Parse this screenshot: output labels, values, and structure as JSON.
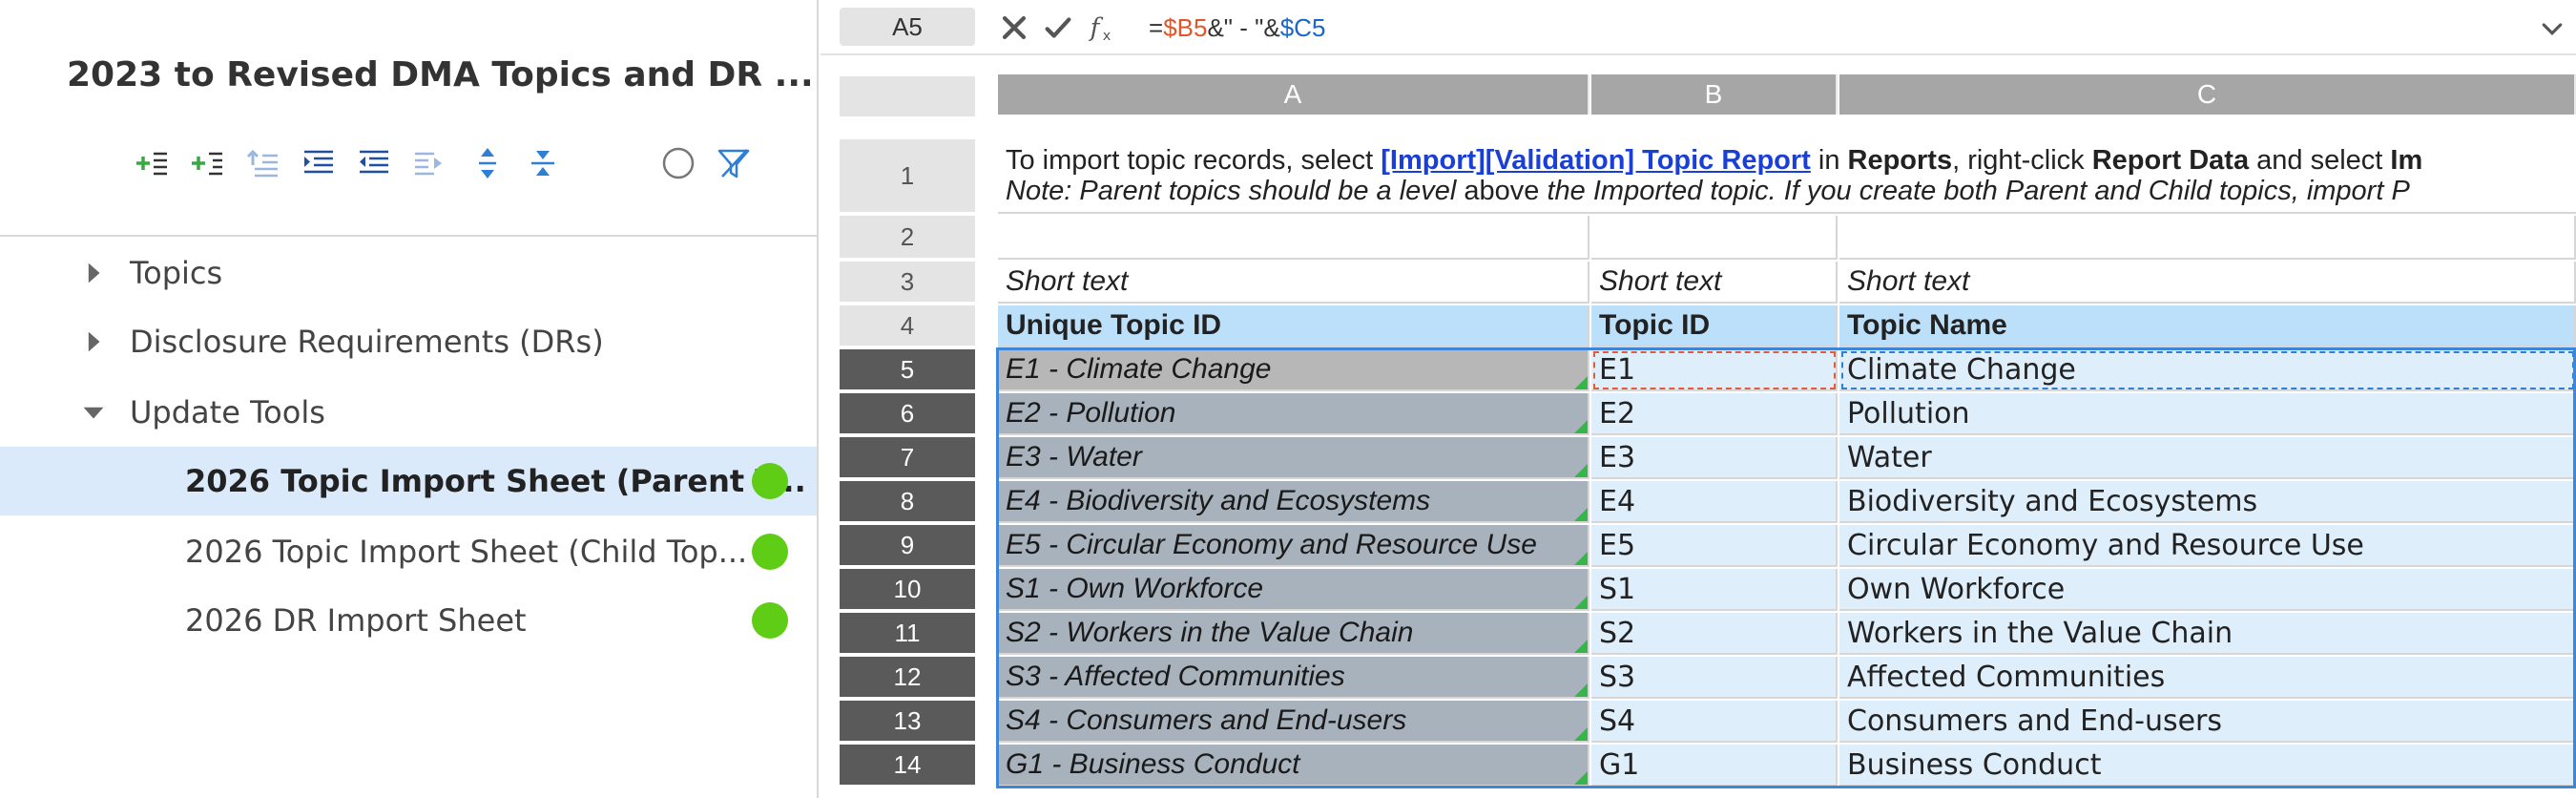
{
  "left_panel": {
    "title": "2023 to Revised DMA Topics and DR ...",
    "toolbar": [
      {
        "name": "add-sibling-icon",
        "color": "#3aa845"
      },
      {
        "name": "add-child-icon",
        "color": "#3aa845"
      },
      {
        "name": "insert-above-icon",
        "color": "#9bb7e0"
      },
      {
        "name": "indent-icon",
        "color": "#1f4f9e"
      },
      {
        "name": "outdent-icon",
        "color": "#1f4f9e"
      },
      {
        "name": "move-right-icon",
        "color": "#9bb7e0"
      },
      {
        "name": "expand-all-icon",
        "color": "#2f7fd6"
      },
      {
        "name": "collapse-all-icon",
        "color": "#2f7fd6"
      },
      {
        "name": "circle-icon",
        "color": "#777777"
      },
      {
        "name": "filter-clear-icon",
        "color": "#2f7fd6"
      }
    ],
    "tree": [
      {
        "label": "Topics",
        "caret": "right",
        "level": 0
      },
      {
        "label": "Disclosure Requirements (DRs)",
        "caret": "right",
        "level": 0
      },
      {
        "label": "Update Tools",
        "caret": "down",
        "level": 0
      },
      {
        "label": "2026 Topic Import Sheet (Parent T...",
        "level": 1,
        "selected": true,
        "status_color": "#5fcc16"
      },
      {
        "label": "2026 Topic Import Sheet (Child Top...",
        "level": 1,
        "selected": false,
        "status_color": "#5fcc16"
      },
      {
        "label": "2026 DR Import Sheet",
        "level": 1,
        "selected": false,
        "status_color": "#5fcc16"
      }
    ]
  },
  "formula_bar": {
    "cell_ref": "A5",
    "formula_parts": [
      {
        "text": "=",
        "style": "plain"
      },
      {
        "text": "$B5",
        "style": "orange"
      },
      {
        "text": "&\" - \"&",
        "style": "plain"
      },
      {
        "text": "$C5",
        "style": "blue"
      }
    ]
  },
  "grid": {
    "columns": [
      "A",
      "B",
      "C"
    ],
    "row1": {
      "line1_parts": [
        {
          "text": "To import topic records, select ",
          "style": "plain"
        },
        {
          "text": "[Import][Validation] Topic Report",
          "style": "link"
        },
        {
          "text": " in ",
          "style": "plain"
        },
        {
          "text": "Reports",
          "style": "bold"
        },
        {
          "text": ", right-click ",
          "style": "plain"
        },
        {
          "text": "Report Data",
          "style": "bold"
        },
        {
          "text": " and select ",
          "style": "plain"
        },
        {
          "text": "Im",
          "style": "bold"
        }
      ],
      "line2_parts": [
        {
          "text": "Note: Parent topics should be a level ",
          "style": "note"
        },
        {
          "text": "above",
          "style": "plain"
        },
        {
          "text": " the Imported topic. If you create both Parent and Child topics, import P",
          "style": "note"
        }
      ]
    },
    "row3": [
      "Short text",
      "Short text",
      "Short text"
    ],
    "row4": [
      "Unique Topic ID",
      "Topic ID",
      "Topic Name"
    ],
    "row_numbers": [
      "1",
      "2",
      "3",
      "4",
      "5",
      "6",
      "7",
      "8",
      "9",
      "10",
      "11",
      "12",
      "13",
      "14"
    ],
    "data_rows": [
      {
        "a": "E1 - Climate Change",
        "b": "E1",
        "c": "Climate Change"
      },
      {
        "a": "E2 - Pollution",
        "b": "E2",
        "c": "Pollution"
      },
      {
        "a": "E3 - Water",
        "b": "E3",
        "c": "Water"
      },
      {
        "a": "E4 - Biodiversity and Ecosystems",
        "b": "E4",
        "c": "Biodiversity and Ecosystems"
      },
      {
        "a": "E5 - Circular Economy and Resource Use",
        "b": "E5",
        "c": "Circular Economy and Resource Use"
      },
      {
        "a": "S1 - Own Workforce",
        "b": "S1",
        "c": "Own Workforce"
      },
      {
        "a": "S2 - Workers in the Value Chain",
        "b": "S2",
        "c": "Workers in the Value Chain"
      },
      {
        "a": "S3 - Affected Communities",
        "b": "S3",
        "c": "Affected Communities"
      },
      {
        "a": "S4 - Consumers and End-users",
        "b": "S4",
        "c": "Consumers and End-users"
      },
      {
        "a": "G1 - Business Conduct",
        "b": "G1",
        "c": "Business Conduct"
      }
    ]
  }
}
